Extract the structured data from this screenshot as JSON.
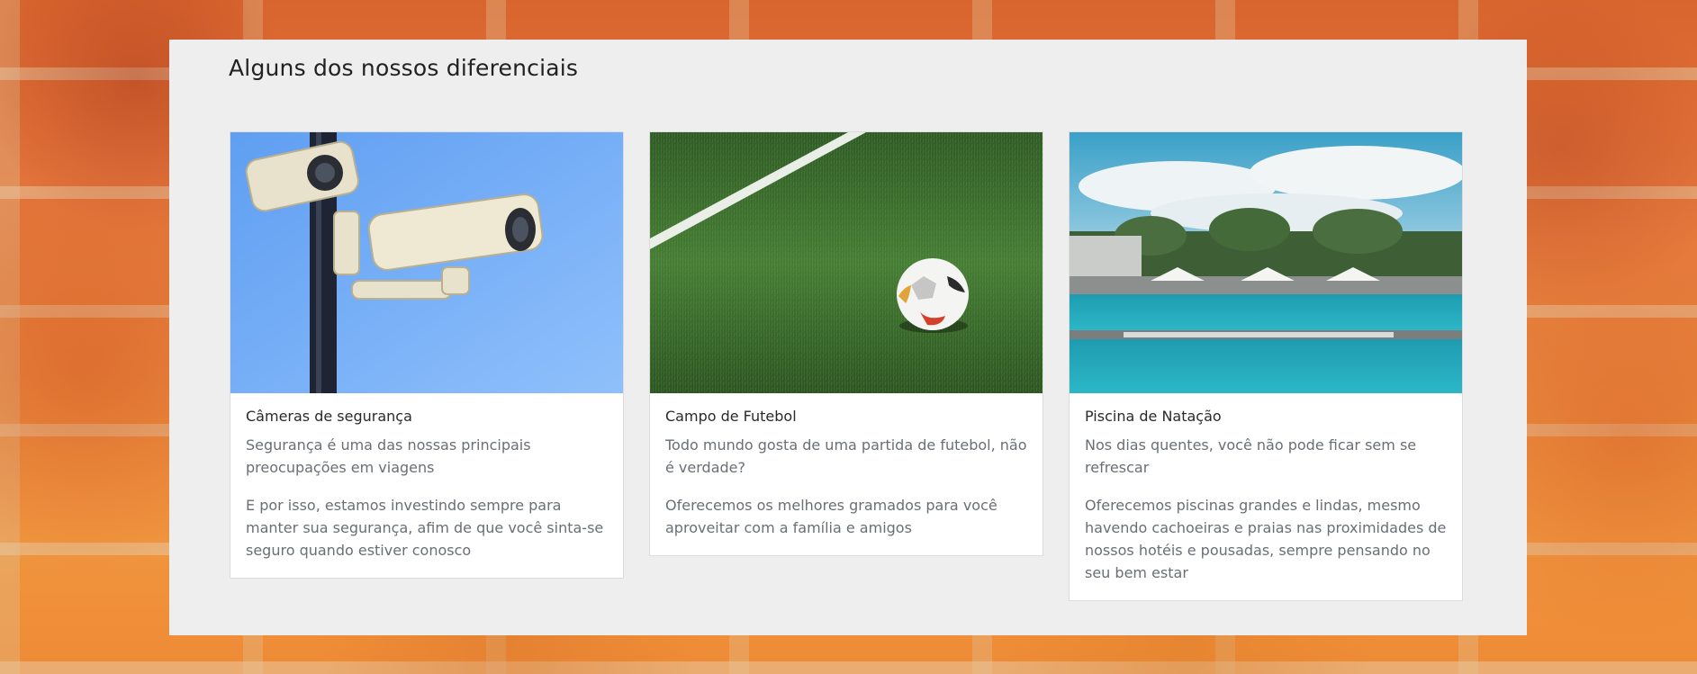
{
  "section": {
    "title": "Alguns dos nossos diferenciais"
  },
  "cards": [
    {
      "image": "security-cameras-photo",
      "title": "Câmeras de segurança",
      "text1": "Segurança é uma das nossas principais preocupações em viagens",
      "text2": "E por isso, estamos investindo sempre para manter sua segurança, afim de que você sinta-se seguro quando estiver conosco"
    },
    {
      "image": "soccer-field-photo",
      "title": "Campo de Futebol",
      "text1": "Todo mundo gosta de uma partida de futebol, não é verdade?",
      "text2": "Oferecemos os melhores gramados para você aproveitar com a família e amigos"
    },
    {
      "image": "swimming-pool-photo",
      "title": "Piscina de Natação",
      "text1": "Nos dias quentes, você não pode ficar sem se refrescar",
      "text2": "Oferecemos piscinas grandes e lindas, mesmo havendo cachoeiras e praias nas proximidades de nossos hotéis e pousadas, sempre pensando no seu bem estar"
    }
  ],
  "colors": {
    "panel": "#eeeeee",
    "card": "#ffffff",
    "title_text": "#222222",
    "body_text": "#6a6f75"
  }
}
